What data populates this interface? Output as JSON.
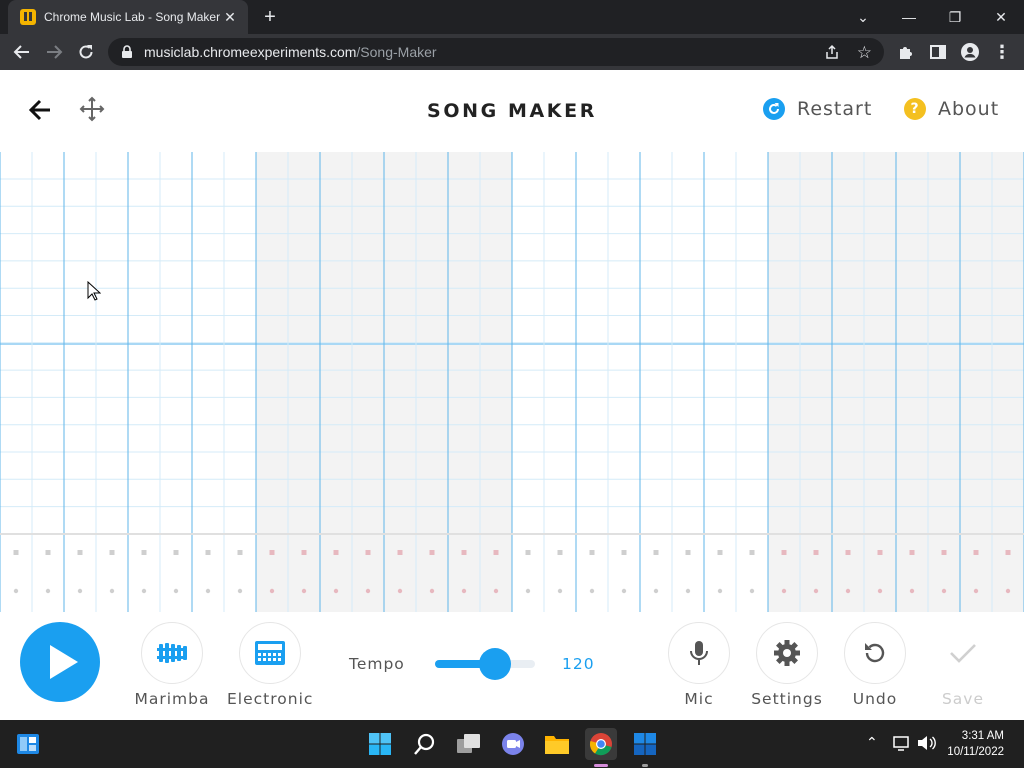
{
  "browser": {
    "tab_title": "Chrome Music Lab - Song Maker",
    "url_host": "musiclab.chromeexperiments.com",
    "url_path": "/Song-Maker"
  },
  "header": {
    "title": "SONG MAKER",
    "restart_label": "Restart",
    "about_label": "About",
    "about_icon_char": "?"
  },
  "controls": {
    "instrument_1": "Marimba",
    "instrument_2": "Electronic",
    "tempo_label": "Tempo",
    "tempo_value": "120",
    "tempo_fraction": 0.6,
    "mic_label": "Mic",
    "settings_label": "Settings",
    "undo_label": "Undo",
    "save_label": "Save"
  },
  "taskbar": {
    "time": "3:31 AM",
    "date": "10/11/2022"
  },
  "colors": {
    "accent": "#1a9ff0",
    "restart_icon": "#1a9ff0",
    "about_icon": "#f4c020",
    "shaded_measure": "#f3f3f3"
  },
  "icons": {
    "back": "arrow-left-icon",
    "move": "move-arrows-icon",
    "restart": "restart-icon",
    "about": "question-icon"
  }
}
